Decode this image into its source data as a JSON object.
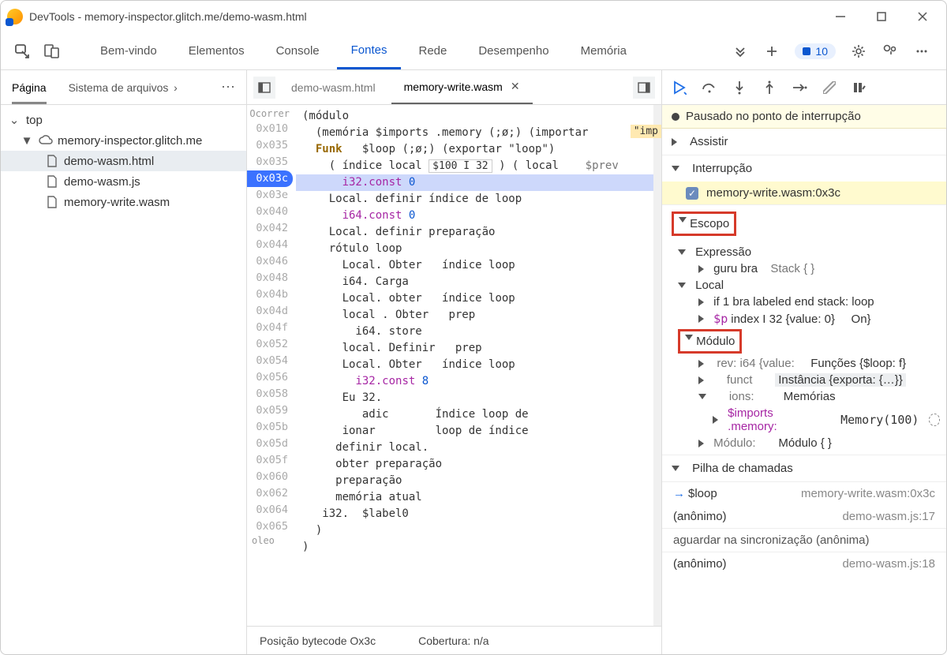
{
  "window": {
    "title": "DevTools - memory-inspector.glitch.me/demo-wasm.html"
  },
  "main_tabs": {
    "items": [
      "Bem-vindo",
      "Elementos",
      "Console",
      "Fontes",
      "Rede",
      "Desempenho",
      "Memória"
    ],
    "active_index": 3,
    "issues_count": "10"
  },
  "left": {
    "tabs": [
      "Página",
      "Sistema de arquivos"
    ],
    "active_index": 0,
    "tree": {
      "top": "top",
      "origin": "memory-inspector.glitch.me",
      "files": [
        "demo-wasm.html",
        "demo-wasm.js",
        "memory-write.wasm"
      ],
      "selected_index": 0
    }
  },
  "editor": {
    "tabs": [
      "demo-wasm.html",
      "memory-write.wasm"
    ],
    "active_index": 1,
    "gutter_top": "Ocorrer",
    "gutter_bottom": "oleo",
    "addresses": [
      "0x010",
      "0x035",
      "0x035",
      "0x03c",
      "0x03e",
      "0x040",
      "0x042",
      "0x044",
      "0x046",
      "0x048",
      "0x04b",
      "0x04d",
      "0x04f",
      "0x052",
      "0x054",
      "0x056",
      "0x058",
      "0x059",
      "0x05b",
      "0x05d",
      "0x05f",
      "0x060",
      "0x062",
      "0x064",
      "0x065"
    ],
    "current_index": 3,
    "lines": {
      "l0": "(módulo",
      "l1": "  (memória $imports .memory (;ø;) (importar",
      "l2a": "Funk",
      "l2b": "$loop (;ø;) (exportar \"loop\")",
      "l3a": "( índice local",
      "l3b": "$100 I 32",
      "l3c": ") ( local",
      "l3d": "$prev",
      "l4": "    i32.const 0",
      "l5": "    Local. definir índice de loop",
      "l6": "    i64.const 0",
      "l7": "    Local. definir preparação",
      "l8": "    rótulo loop",
      "l9a": "      Local. Obter",
      "l9b": "índice loop",
      "l10": "      i64. Carga",
      "l11a": "      Local. obter",
      "l11b": "índice loop",
      "l12a": "      local . Obter",
      "l12b": "prep",
      "l13": "        i64. store",
      "l14a": "      local. Definir",
      "l14b": "prep",
      "l15a": "      Local. Obter",
      "l15b": "índice loop",
      "l16": "      i32.const 8",
      "l17": "      Eu 32.",
      "l18a": "         adic",
      "l18b": "Índice loop de",
      "l19a": "      ionar",
      "l19b": "loop de índice",
      "l20": "     definir local.",
      "l21": "     obter preparação",
      "l22": "     preparação",
      "l23": "     memória atual",
      "l24": "   i32.  $label0",
      "l25": "  )",
      "l26": ")"
    },
    "hint": "\"imp",
    "statusbar": {
      "pos": "Posição bytecode Ox3c",
      "cov": "Cobertura: n/a"
    }
  },
  "debugger": {
    "paused_msg": "Pausado no ponto de interrupção",
    "watch": "Assistir",
    "breakpoints": {
      "title": "Interrupção",
      "item": "memory-write.wasm:0x3c"
    },
    "scope": {
      "title": "Escopo",
      "expr": "Expressão",
      "expr_row": {
        "a": "guru bra",
        "b": "Stack { }"
      },
      "local": "Local",
      "local_row1": "if 1 bra labeled end stack: loop",
      "local_row2a": "$p",
      "local_row2b": "index I 32 {value: 0}",
      "local_row2c": "On}",
      "module": "Módulo",
      "mod_row1a": "rev: i64 {value:",
      "mod_row1b": "Funções {$loop: f}",
      "mod_row2a": "funct",
      "mod_row2b": "Instância {exporta: {…}}",
      "mod_row3a": "ions:",
      "mod_row3b": "Memórias",
      "mod_row4a": "$imports .memory:",
      "mod_row4b": "Memory(100)",
      "mod_row5a": "Módulo:",
      "mod_row5b": "Módulo { }"
    },
    "callstack": {
      "title": "Pilha de chamadas",
      "rows": [
        {
          "name": "$loop",
          "loc": "memory-write.wasm:0x3c"
        },
        {
          "name": "(anônimo)",
          "loc": "demo-wasm.js:17"
        },
        {
          "name": "aguardar na sincronização (anônima)",
          "loc": ""
        },
        {
          "name": "(anônimo)",
          "loc": "demo-wasm.js:18"
        }
      ]
    }
  }
}
